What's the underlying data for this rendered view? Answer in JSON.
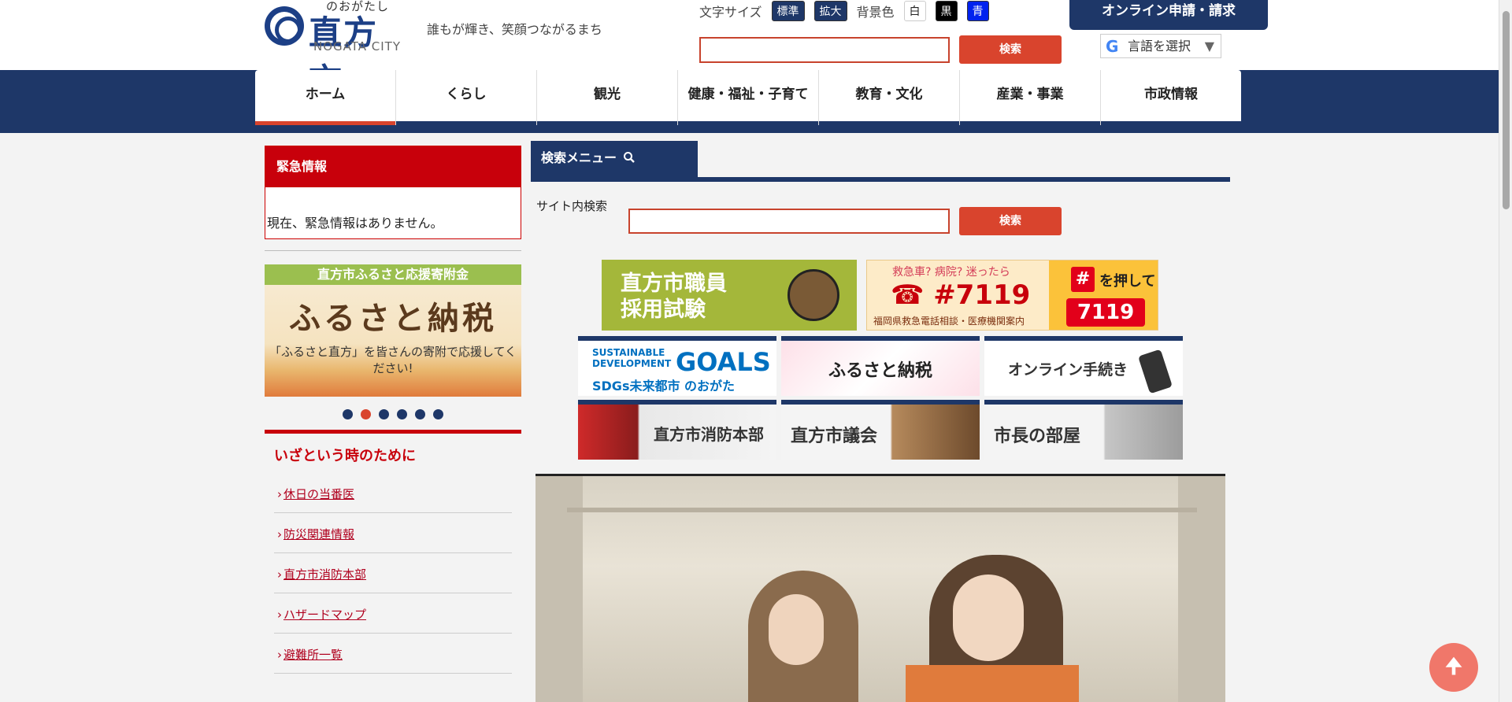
{
  "header": {
    "logo_ruby": "のおがたし",
    "logo_name": "直方市",
    "logo_en": "NOGATA CITY",
    "tagline": "誰もが輝き、笑顔つながるまち",
    "font_size_label": "文字サイズ",
    "font_std": "標準",
    "font_big": "拡大",
    "bg_label": "背景色",
    "bg_white": "白",
    "bg_black": "黒",
    "bg_blue": "青",
    "online_button": "オンライン申請・請求",
    "search_button": "検索",
    "lang_label": "言語を選択",
    "lang_g": "G",
    "lang_caret": "▼"
  },
  "nav": [
    "ホーム",
    "くらし",
    "観光",
    "健康・福祉・子育て",
    "教育・文化",
    "産業・事業",
    "市政情報"
  ],
  "emergency": {
    "title": "緊急情報",
    "body": "現在、緊急情報はありません。"
  },
  "furusato_banner": {
    "top": "直方市ふるさと応援寄附金",
    "main": "ふるさと納税",
    "sub": "「ふるさと直方」を皆さんの寄附で応援してください!"
  },
  "carousel_dots": 6,
  "prep": {
    "title": "いざという時のために",
    "chevron": "›",
    "links": [
      "休日の当番医",
      "防災関連情報",
      "直方市消防本部",
      "ハザードマップ",
      "避難所一覧"
    ]
  },
  "search_menu": {
    "tab": "検索メニュー",
    "icon": "search-icon",
    "site_search_label": "サイト内検索",
    "button": "検索"
  },
  "banners": {
    "recruit": "直方市職員\n採用試験",
    "q7119": "救急車? 病院? 迷ったら",
    "num7119": "☎ #7119",
    "foot7119": "福岡県救急電話相談・医療機関案内",
    "hash": "#",
    "push": "を押して",
    "box7119": "7119",
    "sdg_l1": "SUSTAINABLE\nDEVELOPMENT",
    "sdg_l2": "GOALS",
    "sdg_l3": "SDGs未来都市 のおがた",
    "furusato": "ふるさと納税",
    "online": "オンライン手続き",
    "fire": "直方市消防本部",
    "gikai": "直方市議会",
    "mayor": "市長の部屋"
  },
  "scroll_top_icon": "arrow-up-icon",
  "scroll_top_glyph": "🠉",
  "colors": {
    "navy": "#1e3768",
    "red": "#c8000b",
    "accent": "#d9442d"
  }
}
